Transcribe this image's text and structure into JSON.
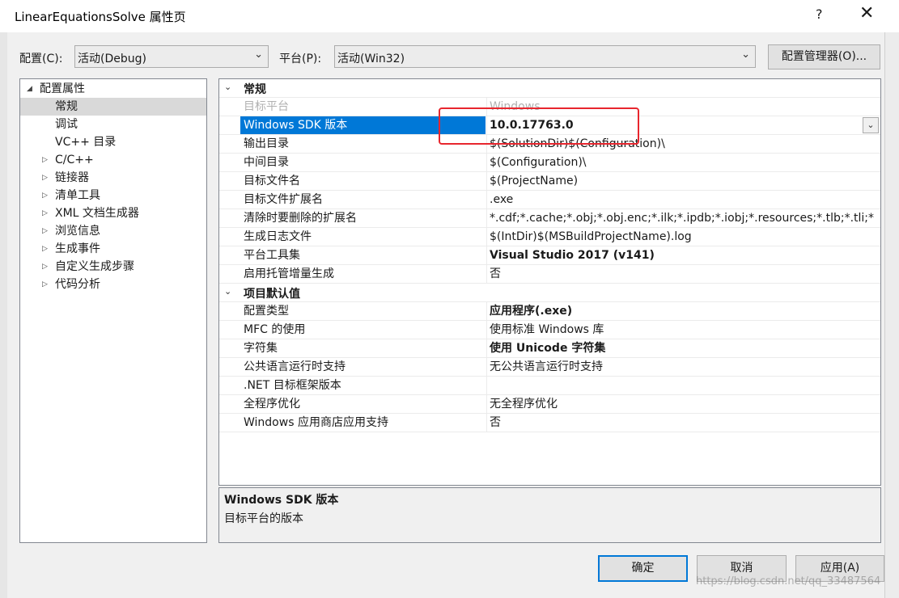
{
  "window": {
    "title": "LinearEquationsSolve 属性页",
    "help_label": "?",
    "close_label": "✕"
  },
  "config": {
    "label": "配置(C):",
    "value": "活动(Debug)",
    "platform_label": "平台(P):",
    "platform_value": "活动(Win32)",
    "manager_button": "配置管理器(O)..."
  },
  "tree": {
    "items": [
      {
        "label": "配置属性",
        "expander": "◢",
        "level": 0
      },
      {
        "label": "常规",
        "expander": "",
        "level": 1,
        "selected": true
      },
      {
        "label": "调试",
        "expander": "",
        "level": 1
      },
      {
        "label": "VC++ 目录",
        "expander": "",
        "level": 1
      },
      {
        "label": "C/C++",
        "expander": "▷",
        "level": 1
      },
      {
        "label": "链接器",
        "expander": "▷",
        "level": 1
      },
      {
        "label": "清单工具",
        "expander": "▷",
        "level": 1
      },
      {
        "label": "XML 文档生成器",
        "expander": "▷",
        "level": 1
      },
      {
        "label": "浏览信息",
        "expander": "▷",
        "level": 1
      },
      {
        "label": "生成事件",
        "expander": "▷",
        "level": 1
      },
      {
        "label": "自定义生成步骤",
        "expander": "▷",
        "level": 1
      },
      {
        "label": "代码分析",
        "expander": "▷",
        "level": 1
      }
    ]
  },
  "grid": {
    "rows": [
      {
        "type": "category",
        "name": "常规",
        "expander": "⌄"
      },
      {
        "type": "prop",
        "name": "目标平台",
        "value": "Windows",
        "dim": true
      },
      {
        "type": "prop",
        "name": "Windows SDK 版本",
        "value": "10.0.17763.0",
        "bold": true,
        "selected": true,
        "dropdown": "⌄"
      },
      {
        "type": "prop",
        "name": "输出目录",
        "value": "$(SolutionDir)$(Configuration)\\"
      },
      {
        "type": "prop",
        "name": "中间目录",
        "value": "$(Configuration)\\"
      },
      {
        "type": "prop",
        "name": "目标文件名",
        "value": "$(ProjectName)"
      },
      {
        "type": "prop",
        "name": "目标文件扩展名",
        "value": ".exe"
      },
      {
        "type": "prop",
        "name": "清除时要删除的扩展名",
        "value": "*.cdf;*.cache;*.obj;*.obj.enc;*.ilk;*.ipdb;*.iobj;*.resources;*.tlb;*.tli;*"
      },
      {
        "type": "prop",
        "name": "生成日志文件",
        "value": "$(IntDir)$(MSBuildProjectName).log"
      },
      {
        "type": "prop",
        "name": "平台工具集",
        "value": "Visual Studio 2017 (v141)",
        "bold": true
      },
      {
        "type": "prop",
        "name": "启用托管增量生成",
        "value": "否"
      },
      {
        "type": "category",
        "name": "项目默认值",
        "expander": "⌄"
      },
      {
        "type": "prop",
        "name": "配置类型",
        "value": "应用程序(.exe)",
        "bold": true
      },
      {
        "type": "prop",
        "name": "MFC 的使用",
        "value": "使用标准 Windows 库"
      },
      {
        "type": "prop",
        "name": "字符集",
        "value": "使用 Unicode 字符集",
        "bold": true
      },
      {
        "type": "prop",
        "name": "公共语言运行时支持",
        "value": "无公共语言运行时支持"
      },
      {
        "type": "prop",
        "name": ".NET 目标框架版本",
        "value": ""
      },
      {
        "type": "prop",
        "name": "全程序优化",
        "value": "无全程序优化"
      },
      {
        "type": "prop",
        "name": "Windows 应用商店应用支持",
        "value": "否"
      }
    ]
  },
  "description": {
    "title": "Windows SDK 版本",
    "text": "目标平台的版本"
  },
  "buttons": {
    "ok": "确定",
    "cancel": "取消",
    "apply": "应用(A)"
  },
  "watermark": "https://blog.csdn.net/qq_33487564",
  "colors": {
    "selection": "#0078d7",
    "highlight_box": "#e8262e"
  }
}
